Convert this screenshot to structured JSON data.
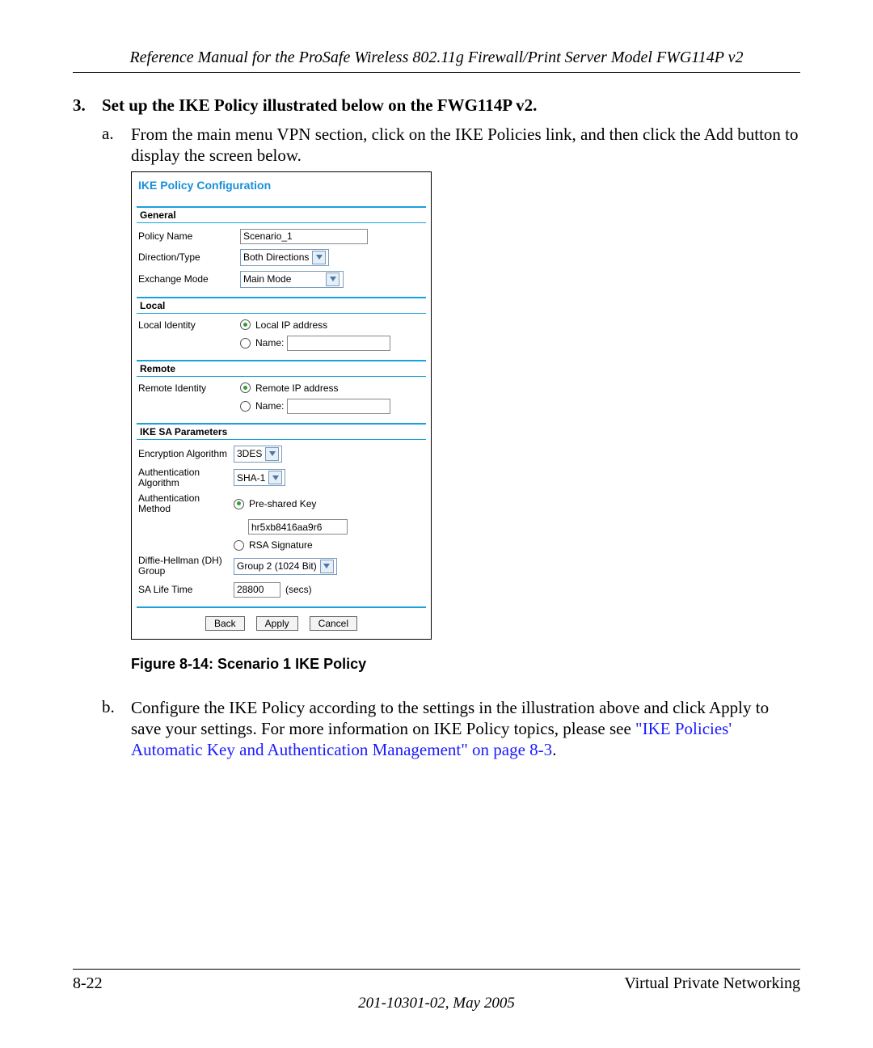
{
  "header": {
    "title": "Reference Manual for the ProSafe Wireless 802.11g  Firewall/Print Server Model FWG114P v2"
  },
  "step": {
    "number": "3.",
    "text": "Set up the IKE Policy illustrated below on the FWG114P v2."
  },
  "sub_a": {
    "letter": "a.",
    "text": "From the main menu VPN section, click on the IKE Policies link, and then click the Add button to display the screen below."
  },
  "sub_b": {
    "letter": "b.",
    "text_pre": "Configure the IKE Policy according to the settings in the illustration above and click Apply to save your settings. For more information on IKE Policy topics, please see ",
    "link_text": "\"IKE Policies' Automatic Key and Authentication Management\" on page 8-3",
    "text_post": "."
  },
  "figure_caption": "Figure 8-14:  Scenario 1 IKE Policy",
  "shot": {
    "title": "IKE Policy Configuration",
    "general": {
      "head": "General",
      "policy_name_label": "Policy Name",
      "policy_name_value": "Scenario_1",
      "direction_label": "Direction/Type",
      "direction_value": "Both Directions",
      "exchange_label": "Exchange Mode",
      "exchange_value": "Main Mode"
    },
    "local": {
      "head": "Local",
      "identity_label": "Local Identity",
      "opt_ip": "Local IP address",
      "opt_name_label": "Name:"
    },
    "remote": {
      "head": "Remote",
      "identity_label": "Remote Identity",
      "opt_ip": "Remote IP address",
      "opt_name_label": "Name:"
    },
    "sa": {
      "head": "IKE SA Parameters",
      "enc_label": "Encryption Algorithm",
      "enc_value": "3DES",
      "auth_algo_label": "Authentication Algorithm",
      "auth_algo_value": "SHA-1",
      "auth_method_label": "Authentication Method",
      "psk_label": "Pre-shared Key",
      "psk_value": "hr5xb8416aa9r6",
      "rsa_label": "RSA Signature",
      "dh_label": "Diffie-Hellman (DH) Group",
      "dh_value": "Group 2 (1024 Bit)",
      "salife_label": "SA Life Time",
      "salife_value": "28800",
      "salife_units": "(secs)"
    },
    "buttons": {
      "back": "Back",
      "apply": "Apply",
      "cancel": "Cancel"
    }
  },
  "footer": {
    "page": "8-22",
    "section": "Virtual Private Networking",
    "docid": "201-10301-02, May 2005"
  }
}
